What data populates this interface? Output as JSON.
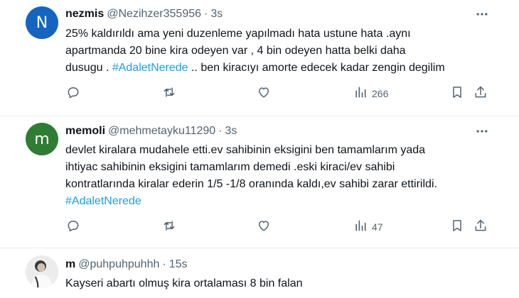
{
  "tweets": [
    {
      "avatar_letter": "N",
      "avatar_color": "#1565c0",
      "name": "nezmis",
      "handle": "@Nezihzer355956",
      "dot": "·",
      "time": "3s",
      "lines": [
        "25% kaldırıldı ama yeni duzenleme yapılmadı hata ustune hata .aynı",
        "apartmanda 20 bine  kira odeyen var , 4 bin odeyen hatta belki daha"
      ],
      "line3_before": "dusugu . ",
      "hashtag": "#AdaletNerede",
      "line3_after": " .. ben kiracıyı amorte edecek kadar zengin degilim",
      "views": "266"
    },
    {
      "avatar_letter": "m",
      "avatar_color": "#2e7d32",
      "name": "memoli",
      "handle": "@mehmetayku11290",
      "dot": "·",
      "time": "3s",
      "lines": [
        "devlet kiralara mudahele etti.ev sahibinin eksigini ben tamamlarım yada",
        "ihtiyac sahibinin eksigini tamamlarım demedi .eski kiraci/ev sahibi",
        "kontratlarında kiralar ederin 1/5 -1/8 oranında kaldı,ev sahibi zarar ettirildi."
      ],
      "hashtag": "#AdaletNerede",
      "views": "47"
    },
    {
      "name": "m",
      "handle": "@puhpuhpuhhh",
      "dot": "·",
      "time": "15s",
      "line": "Kayseri abartı olmuş kira ortalaması 8 bin falan"
    }
  ],
  "icons": {
    "more": "more-horizontal-icon",
    "reply": "reply-icon",
    "retweet": "retweet-icon",
    "like": "like-icon",
    "views": "views-icon",
    "bookmark": "bookmark-icon",
    "share": "share-icon"
  }
}
